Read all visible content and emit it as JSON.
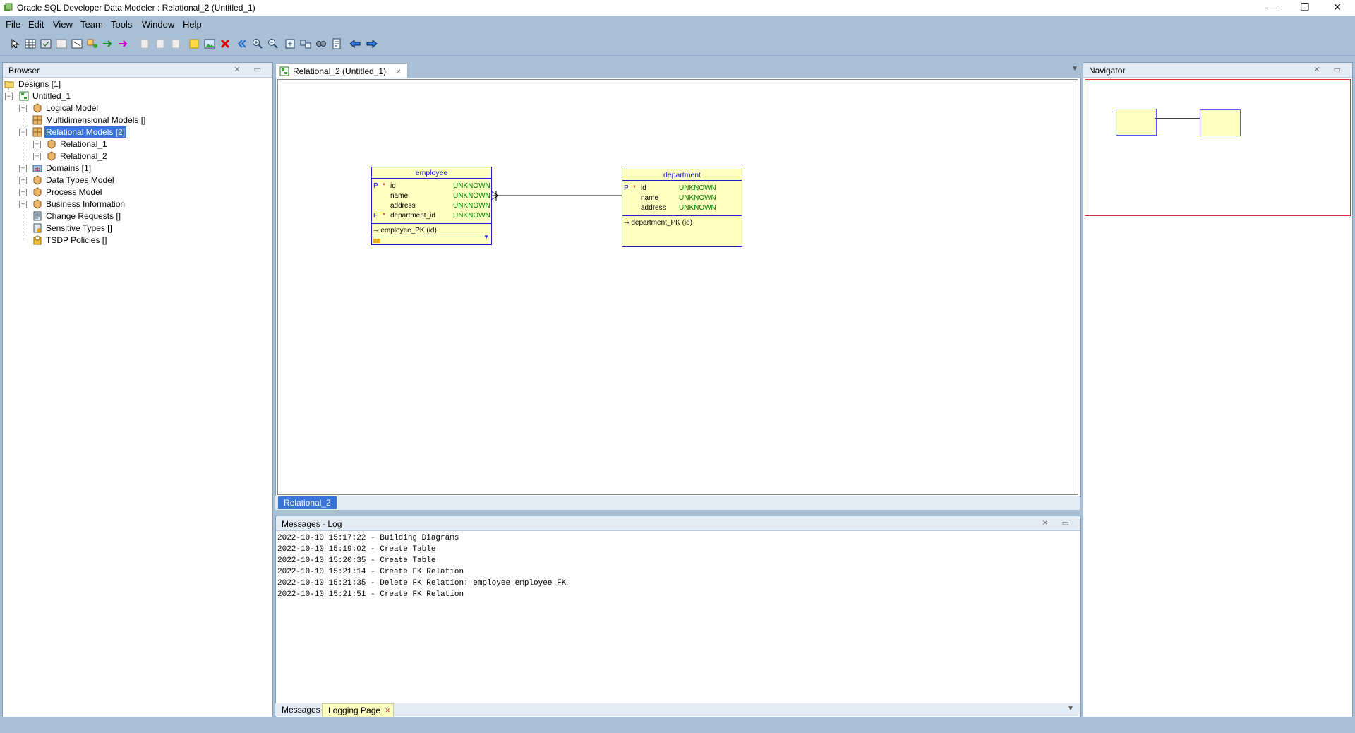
{
  "window": {
    "title": "Oracle SQL Developer Data Modeler : Relational_2 (Untitled_1)",
    "minimize": "—",
    "restore": "❐",
    "close": "✕"
  },
  "menu": {
    "items": [
      "File",
      "Edit",
      "View",
      "Team",
      "Tools",
      "Window",
      "Help"
    ]
  },
  "browser": {
    "title": "Browser",
    "tree": {
      "designs": "Designs [1]",
      "untitled": "Untitled_1",
      "logical_model": "Logical Model",
      "multidimensional_models": "Multidimensional Models []",
      "relational_models": "Relational Models [2]",
      "relational_1": "Relational_1",
      "relational_2": "Relational_2",
      "domains": "Domains [1]",
      "data_types_model": "Data Types Model",
      "process_model": "Process Model",
      "business_information": "Business Information",
      "change_requests": "Change Requests []",
      "sensitive_types": "Sensitive Types []",
      "tsdp_policies": "TSDP Policies []"
    }
  },
  "editor": {
    "tab_label": "Relational_2 (Untitled_1)",
    "subtab_label": "Relational_2"
  },
  "diagram": {
    "employee": {
      "name": "employee",
      "columns": [
        {
          "key": "P",
          "mandatory": "*",
          "name": "id",
          "type": "UNKNOWN"
        },
        {
          "key": "",
          "mandatory": "",
          "name": "name",
          "type": "UNKNOWN"
        },
        {
          "key": "",
          "mandatory": "",
          "name": "address",
          "type": "UNKNOWN"
        },
        {
          "key": "F",
          "mandatory": "*",
          "name": "department_id",
          "type": "UNKNOWN"
        }
      ],
      "pk": "employee_PK (id)"
    },
    "department": {
      "name": "department",
      "columns": [
        {
          "key": "P",
          "mandatory": "*",
          "name": "id",
          "type": "UNKNOWN"
        },
        {
          "key": "",
          "mandatory": "",
          "name": "name",
          "type": "UNKNOWN"
        },
        {
          "key": "",
          "mandatory": "",
          "name": "address",
          "type": "UNKNOWN"
        }
      ],
      "pk": "department_PK (id)"
    }
  },
  "messages": {
    "title": "Messages - Log",
    "lines": [
      "2022-10-10 15:17:22 - Building Diagrams",
      "2022-10-10 15:19:02 - Create Table",
      "2022-10-10 15:20:35 - Create Table",
      "2022-10-10 15:21:14 - Create FK Relation",
      "2022-10-10 15:21:35 - Delete FK Relation: employee_employee_FK",
      "2022-10-10 15:21:51 - Create FK Relation"
    ],
    "tabs": [
      "Messages",
      "Logging Page"
    ]
  },
  "navigator": {
    "title": "Navigator"
  },
  "colors": {
    "chrome": "#a9bfd6",
    "table_fill": "#ffffc0",
    "table_border": "#1e1ec8",
    "selection": "#3875d7",
    "type_text": "#008000"
  }
}
